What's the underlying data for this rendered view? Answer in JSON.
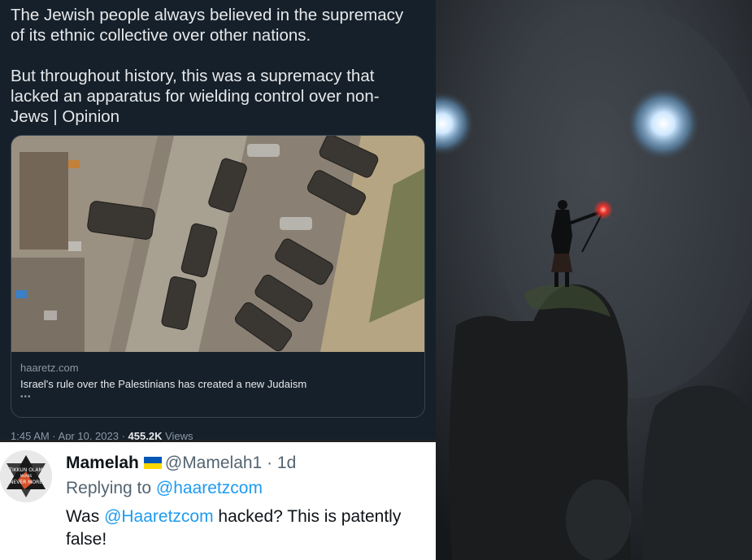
{
  "tweet": {
    "text": "The Jewish people always believed in the supremacy\nof its ethnic collective over other nations.\n\nBut throughout history, this was a supremacy that\nlacked an apparatus for wielding control over non-\nJews | Opinion",
    "card": {
      "domain": "haaretz.com",
      "headline": "Israel's rule over the Palestinians has created a new Judaism",
      "dots": "•••"
    },
    "meta": {
      "time": "1:45 AM · Apr 10, 2023 · ",
      "views_count": "455.2K",
      "views_label": " Views"
    }
  },
  "reply": {
    "display_name": "Mamelah",
    "flag": "ukraine-flag",
    "handle": "@Mamelah1",
    "separator": " · ",
    "age": "1d",
    "replying_prefix": "Replying to ",
    "replying_handle": "@haaretzcom",
    "text_prefix": "Was ",
    "text_mention": "@Haaretzcom",
    "text_suffix": " hacked? This is patently false!",
    "avatar_text": {
      "line1": "TIKKUN OLAM",
      "line2": "MEANS",
      "line3": "NEVER MORE"
    }
  },
  "colors": {
    "dark_bg": "#15202b",
    "link_blue": "#1d9bf0",
    "secondary_text": "#536471"
  }
}
